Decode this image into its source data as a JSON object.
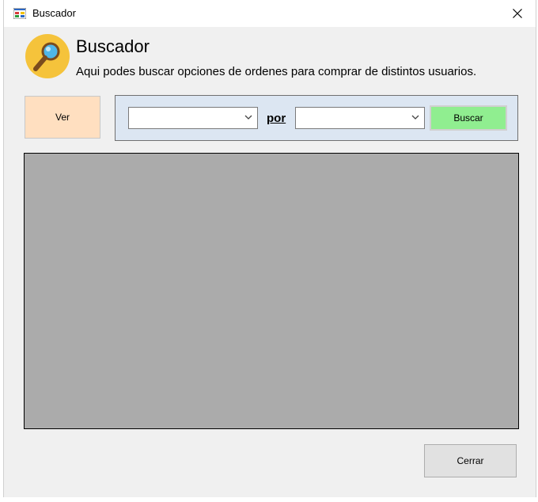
{
  "window": {
    "title": "Buscador"
  },
  "header": {
    "title": "Buscador",
    "description": "Aqui podes buscar opciones de ordenes para comprar de distintos usuarios."
  },
  "actions": {
    "ver_label": "Ver",
    "buscar_label": "Buscar",
    "cerrar_label": "Cerrar"
  },
  "filter": {
    "first_combo_value": "",
    "por_label": "por",
    "second_combo_value": ""
  },
  "icons": {
    "app": "app-window-icon",
    "close": "close-icon",
    "header": "magnifier-icon",
    "combo_arrow": "chevron-down-icon"
  },
  "colors": {
    "ver_button": "#ffdfc0",
    "buscar_button": "#90ee90",
    "filter_panel": "#dce6f2",
    "grid_background": "#ababab",
    "header_icon_circle": "#f5c33b"
  }
}
